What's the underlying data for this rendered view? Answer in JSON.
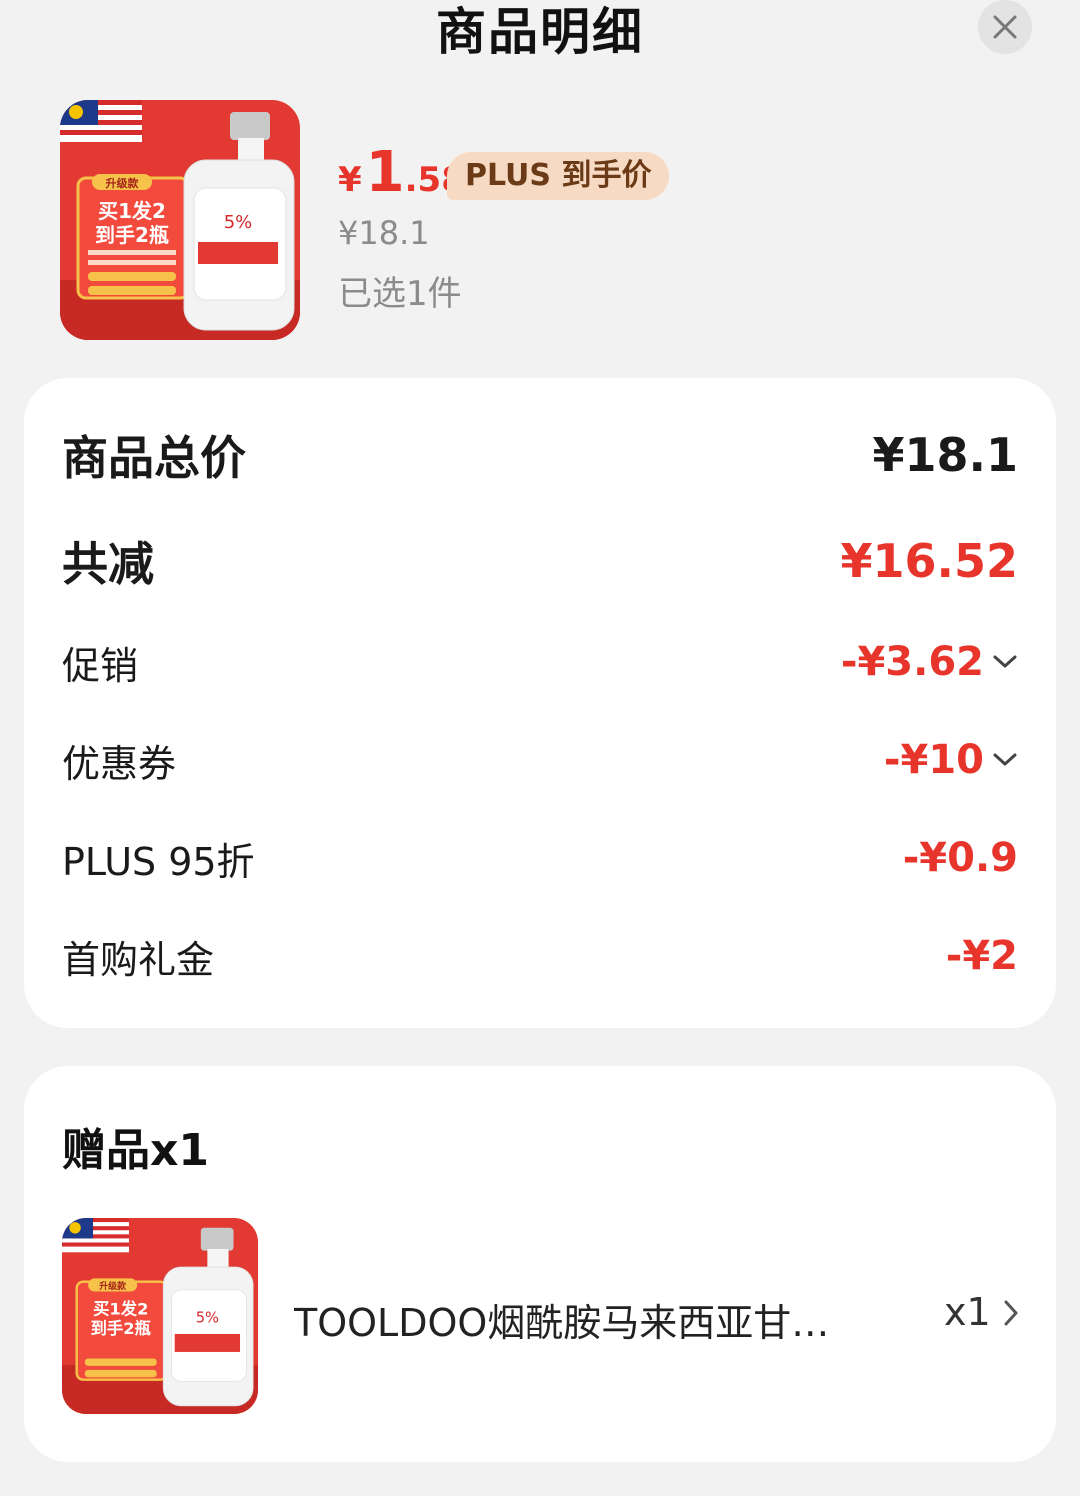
{
  "header": {
    "title": "商品明细"
  },
  "product": {
    "currency": "¥",
    "price_int": "1",
    "price_dec": ".58",
    "plus_badge": "PLUS 到手价",
    "original_price": "¥18.1",
    "selected": "已选1件",
    "thumb_text": {
      "tag": "升级款",
      "line1": "买1发2",
      "line2": "到手2瓶",
      "percent": "5%"
    }
  },
  "summary": {
    "total_label": "商品总价",
    "total_value": "¥18.1",
    "discount_label": "共减",
    "discount_value": "¥16.52",
    "items": [
      {
        "label": "促销",
        "value": "-¥3.62",
        "expandable": true
      },
      {
        "label": "优惠券",
        "value": "-¥10",
        "expandable": true
      },
      {
        "label": "PLUS 95折",
        "value": "-¥0.9",
        "expandable": false
      },
      {
        "label": "首购礼金",
        "value": "-¥2",
        "expandable": false
      }
    ]
  },
  "gift": {
    "title": "赠品x1",
    "name": "TOOLDOO烟酰胺马来西亚甘…",
    "qty": "x1"
  },
  "colors": {
    "accent_red": "#e8352b",
    "badge_bg": "#f7dac3",
    "badge_text": "#6b3a17"
  }
}
